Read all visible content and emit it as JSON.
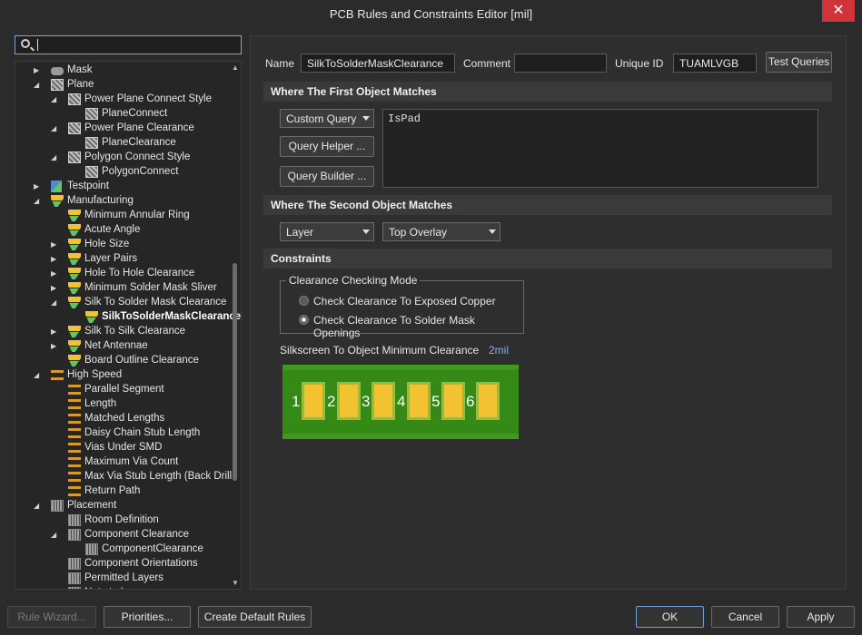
{
  "window": {
    "title": "PCB Rules and Constraints Editor [mil]",
    "close_glyph": "✕"
  },
  "search": {
    "placeholder": "",
    "value": ""
  },
  "tree": [
    {
      "label": "Mask",
      "icon": "mask-icon",
      "indent": 0,
      "expander": "▶"
    },
    {
      "label": "Plane",
      "icon": "grid-icon",
      "indent": 0,
      "expander": "◢"
    },
    {
      "label": "Power Plane Connect Style",
      "icon": "grid-icon",
      "indent": 1,
      "expander": "◢"
    },
    {
      "label": "PlaneConnect",
      "icon": "grid-icon",
      "indent": 2,
      "expander": ""
    },
    {
      "label": "Power Plane Clearance",
      "icon": "grid-icon",
      "indent": 1,
      "expander": "◢"
    },
    {
      "label": "PlaneClearance",
      "icon": "grid-icon",
      "indent": 2,
      "expander": ""
    },
    {
      "label": "Polygon Connect Style",
      "icon": "grid-icon",
      "indent": 1,
      "expander": "◢"
    },
    {
      "label": "PolygonConnect",
      "icon": "grid-icon",
      "indent": 2,
      "expander": ""
    },
    {
      "label": "Testpoint",
      "icon": "testpoint-icon",
      "indent": 0,
      "expander": "▶"
    },
    {
      "label": "Manufacturing",
      "icon": "manufacturing-icon",
      "indent": 0,
      "expander": "◢"
    },
    {
      "label": "Minimum Annular Ring",
      "icon": "manufacturing-icon",
      "indent": 1,
      "expander": ""
    },
    {
      "label": "Acute Angle",
      "icon": "manufacturing-icon",
      "indent": 1,
      "expander": ""
    },
    {
      "label": "Hole Size",
      "icon": "manufacturing-icon",
      "indent": 1,
      "expander": "▶"
    },
    {
      "label": "Layer Pairs",
      "icon": "manufacturing-icon",
      "indent": 1,
      "expander": "▶"
    },
    {
      "label": "Hole To Hole Clearance",
      "icon": "manufacturing-icon",
      "indent": 1,
      "expander": "▶"
    },
    {
      "label": "Minimum Solder Mask Sliver",
      "icon": "manufacturing-icon",
      "indent": 1,
      "expander": "▶"
    },
    {
      "label": "Silk To Solder Mask Clearance",
      "icon": "manufacturing-icon",
      "indent": 1,
      "expander": "◢"
    },
    {
      "label": "SilkToSolderMaskClearance",
      "icon": "manufacturing-icon",
      "indent": 2,
      "expander": "",
      "selected": true
    },
    {
      "label": "Silk To Silk Clearance",
      "icon": "manufacturing-icon",
      "indent": 1,
      "expander": "▶"
    },
    {
      "label": "Net Antennae",
      "icon": "manufacturing-icon",
      "indent": 1,
      "expander": "▶"
    },
    {
      "label": "Board Outline Clearance",
      "icon": "manufacturing-icon",
      "indent": 1,
      "expander": ""
    },
    {
      "label": "High Speed",
      "icon": "high-speed-icon",
      "indent": 0,
      "expander": "◢"
    },
    {
      "label": "Parallel Segment",
      "icon": "high-speed-icon",
      "indent": 1,
      "expander": ""
    },
    {
      "label": "Length",
      "icon": "high-speed-icon",
      "indent": 1,
      "expander": ""
    },
    {
      "label": "Matched Lengths",
      "icon": "high-speed-icon",
      "indent": 1,
      "expander": ""
    },
    {
      "label": "Daisy Chain Stub Length",
      "icon": "high-speed-icon",
      "indent": 1,
      "expander": ""
    },
    {
      "label": "Vias Under SMD",
      "icon": "high-speed-icon",
      "indent": 1,
      "expander": ""
    },
    {
      "label": "Maximum Via Count",
      "icon": "high-speed-icon",
      "indent": 1,
      "expander": ""
    },
    {
      "label": "Max Via Stub Length (Back Drill",
      "icon": "high-speed-icon",
      "indent": 1,
      "expander": ""
    },
    {
      "label": "Return Path",
      "icon": "high-speed-icon",
      "indent": 1,
      "expander": ""
    },
    {
      "label": "Placement",
      "icon": "placement-icon",
      "indent": 0,
      "expander": "◢"
    },
    {
      "label": "Room Definition",
      "icon": "placement-icon",
      "indent": 1,
      "expander": ""
    },
    {
      "label": "Component Clearance",
      "icon": "placement-icon",
      "indent": 1,
      "expander": "◢"
    },
    {
      "label": "ComponentClearance",
      "icon": "placement-icon",
      "indent": 2,
      "expander": ""
    },
    {
      "label": "Component Orientations",
      "icon": "placement-icon",
      "indent": 1,
      "expander": ""
    },
    {
      "label": "Permitted Layers",
      "icon": "placement-icon",
      "indent": 1,
      "expander": ""
    },
    {
      "label": "Nets to Ignore",
      "icon": "placement-icon",
      "indent": 1,
      "expander": ""
    }
  ],
  "rule": {
    "name_label": "Name",
    "name_value": "SilkToSolderMaskClearance",
    "comment_label": "Comment",
    "comment_value": "",
    "uid_label": "Unique ID",
    "uid_value": "TUAMLVGB",
    "test_queries_label": "Test Queries"
  },
  "first_match": {
    "header": "Where The First Object Matches",
    "dropdown_value": "Custom Query",
    "query_helper_label": "Query Helper ...",
    "query_builder_label": "Query Builder ...",
    "query_text": "IsPad"
  },
  "second_match": {
    "header": "Where The Second Object Matches",
    "type_value": "Layer",
    "layer_value": "Top Overlay"
  },
  "constraints": {
    "header": "Constraints",
    "mode_legend": "Clearance Checking Mode",
    "option_copper": "Check Clearance To Exposed Copper",
    "option_mask": "Check Clearance To Solder Mask Openings",
    "selected_option": "mask",
    "silk_label": "Silkscreen To Object Minimum Clearance",
    "silk_value": "2mil",
    "pad_numbers": [
      "1",
      "2",
      "3",
      "4",
      "5",
      "6"
    ],
    "board_color": "#3e9a1c",
    "pad_color": "#f2c230"
  },
  "footer": {
    "rule_wizard": "Rule Wizard...",
    "priorities": "Priorities...",
    "create_default": "Create Default Rules",
    "ok": "OK",
    "cancel": "Cancel",
    "apply": "Apply"
  }
}
